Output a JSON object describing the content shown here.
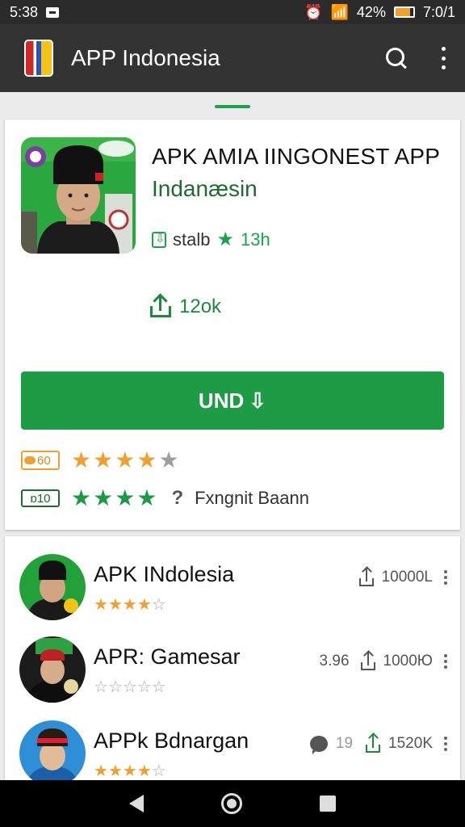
{
  "status_bar": {
    "time": "5:38",
    "battery_percent": "42%",
    "clock_right": "7:0/1",
    "battery_level": 0.8
  },
  "app_bar": {
    "title": "APP Indonesia",
    "search_icon": "search-icon",
    "more_icon": "more-vert-icon"
  },
  "hero": {
    "title": "APK AMIA IINGONEST APP",
    "subtitle": "Indanæsin",
    "meta_label": "stalb",
    "meta_value": "13h",
    "downloads": "12ok",
    "install_label": "UND",
    "rating_1": {
      "badge": "60",
      "stars_filled": 4,
      "stars_total": 5
    },
    "rating_2": {
      "badge": "ɒ10",
      "stars_filled": 4,
      "text": "Fxngnit Baann"
    }
  },
  "list": [
    {
      "name": "APK INdolesia",
      "downloads": "10000L",
      "stars_filled": 4,
      "stars_total": 5
    },
    {
      "name": "APR: Gamesar",
      "downloads": "1000Ю",
      "size": "3.96",
      "stars_filled": 0,
      "stars_total": 5
    },
    {
      "name": "APPk Bdnargan",
      "downloads": "1520K",
      "comments": "19",
      "stars_filled": 4,
      "stars_total": 5
    }
  ],
  "nav": {
    "back": "back-icon",
    "home": "home-icon",
    "recents": "recents-icon"
  },
  "colors": {
    "accent": "#1e9b45",
    "star": "#f0a030",
    "app_bar": "#333333"
  }
}
